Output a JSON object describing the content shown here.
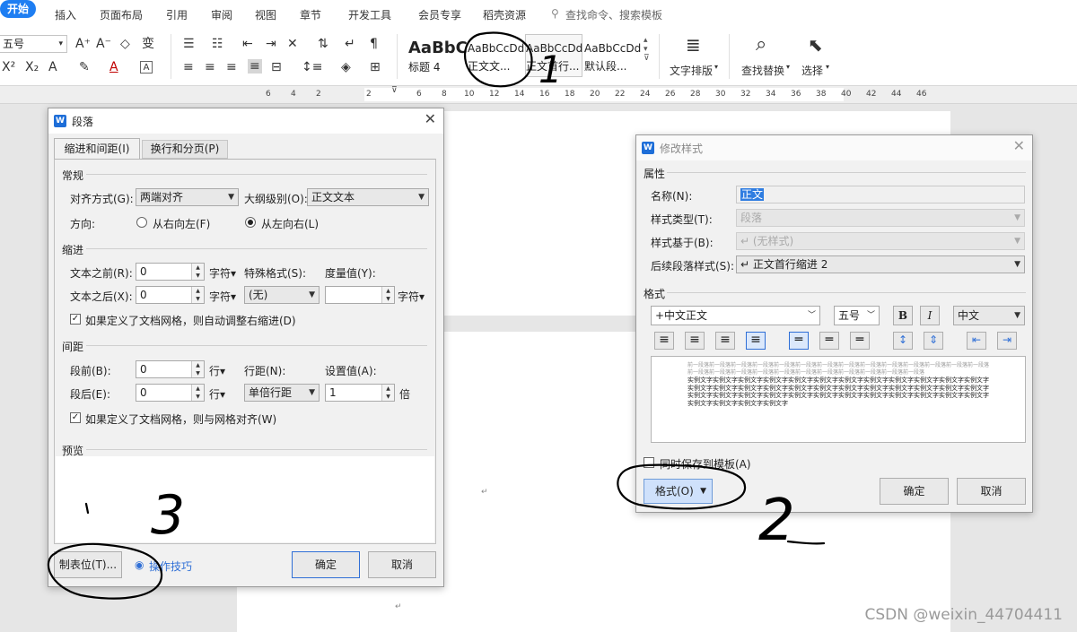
{
  "menu": {
    "tabs": [
      "开始",
      "插入",
      "页面布局",
      "引用",
      "审阅",
      "视图",
      "章节",
      "开发工具",
      "会员专享",
      "稻壳资源"
    ],
    "search_placeholder": "查找命令、搜索模板"
  },
  "ribbon": {
    "font_size": "五号",
    "styles": [
      {
        "preview": "AaBbC",
        "label": "标题 4"
      },
      {
        "preview": "AaBbCcDd",
        "label": "正文文..."
      },
      {
        "preview": "AaBbCcDd",
        "label": "正文首行..."
      },
      {
        "preview": "AaBbCcDd",
        "label": "默认段..."
      }
    ],
    "text_layout": "文字排版",
    "find_replace": "查找替换",
    "select": "选择"
  },
  "ruler": {
    "ticks": [
      "6",
      "4",
      "2",
      "2",
      "4",
      "6",
      "8",
      "10",
      "12",
      "14",
      "16",
      "18",
      "20",
      "22",
      "24",
      "26",
      "28",
      "30",
      "32",
      "34",
      "36",
      "38",
      "40",
      "42",
      "44",
      "46"
    ]
  },
  "paragraph_dialog": {
    "title": "段落",
    "tabs": [
      "缩进和间距(I)",
      "换行和分页(P)"
    ],
    "general": {
      "section": "常规",
      "align_label": "对齐方式(G):",
      "align_value": "两端对齐",
      "outline_label": "大纲级别(O):",
      "outline_value": "正文文本",
      "direction_label": "方向:",
      "rtl": "从右向左(F)",
      "ltr": "从左向右(L)"
    },
    "indent": {
      "section": "缩进",
      "before_label": "文本之前(R):",
      "before_value": "0",
      "after_label": "文本之后(X):",
      "after_value": "0",
      "unit": "字符",
      "special_label": "特殊格式(S):",
      "special_value": "(无)",
      "measure_label": "度量值(Y):",
      "measure_value": "",
      "measure_unit": "字符",
      "grid_check": "如果定义了文档网格，则自动调整右缩进(D)"
    },
    "spacing": {
      "section": "间距",
      "before_label": "段前(B):",
      "before_value": "0",
      "after_label": "段后(E):",
      "after_value": "0",
      "unit": "行",
      "line_label": "行距(N):",
      "line_value": "单倍行距",
      "set_label": "设置值(A):",
      "set_value": "1",
      "set_unit": "倍",
      "grid_check": "如果定义了文档网格，则与网格对齐(W)"
    },
    "preview_label": "预览",
    "tabs_button": "制表位(T)...",
    "tips": "操作技巧",
    "ok": "确定",
    "cancel": "取消"
  },
  "modify_style_dialog": {
    "title": "修改样式",
    "props_section": "属性",
    "name_label": "名称(N):",
    "name_value": "正文",
    "type_label": "样式类型(T):",
    "type_value": "段落",
    "based_label": "样式基于(B):",
    "based_value": "(无样式)",
    "next_label": "后续段落样式(S):",
    "next_value": "正文首行缩进 2",
    "format_section": "格式",
    "font_value": "+中文正文",
    "size_value": "五号",
    "bold": "B",
    "italic": "I",
    "lang_value": "中文",
    "preview_prev": "前一段落前一段落前一段落前一段落前一段落前一段落前一段落前一段落前一段落前一段落前一段落前一段落前一段落前一段落前一段落前一段落前一段落前一段落前一段落前一段落前一段落前一段落前一段落前一段落前一段落",
    "preview_sample": "实例文字实例文字实例文字实例文字实例文字实例文字实例文字实例文字实例文字实例文字实例文字实例文字实例文字实例文字实例文字实例文字实例文字实例文字实例文字实例文字实例文字实例文字实例文字实例文字实例文字实例文字实例文字实例文字实例文字实例文字实例文字实例文字实例文字实例文字实例文字实例文字实例文字实例文字实例文字实例文字",
    "save_template": "同时保存到模板(A)",
    "format_button": "格式(O)",
    "ok": "确定",
    "cancel": "取消"
  },
  "annotations": {
    "one": "1",
    "two": "2",
    "three": "3"
  },
  "watermark": "CSDN @weixin_44704411"
}
